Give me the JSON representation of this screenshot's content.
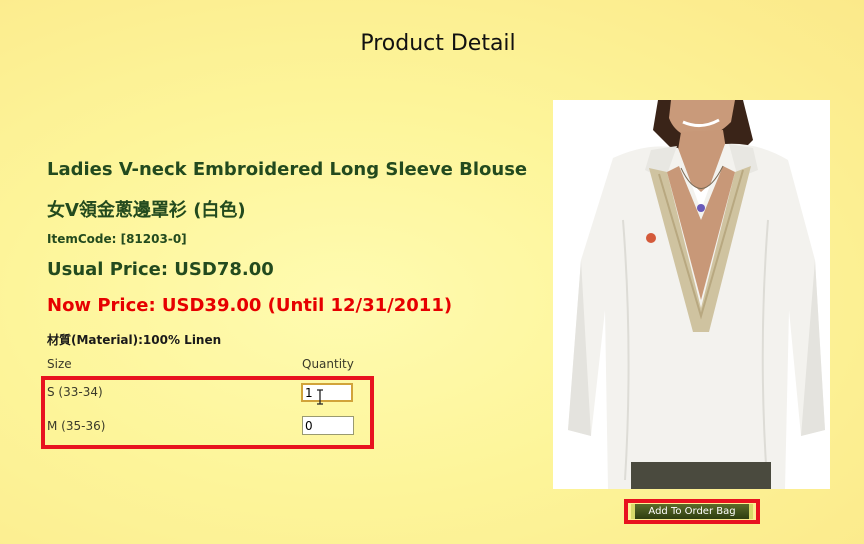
{
  "page": {
    "title": "Product Detail"
  },
  "product": {
    "name": "Ladies V-neck Embroidered Long Sleeve Blouse",
    "name_cn": "女V領金蔥邊罩衫 (白色)",
    "item_code": "ItemCode: [81203-0]",
    "usual_price": "Usual Price: USD78.00",
    "now_price": "Now Price: USD39.00 (Until 12/31/2011)",
    "material": "材質(Material):100% Linen"
  },
  "order_table": {
    "size_header": "Size",
    "quantity_header": "Quantity",
    "rows": [
      {
        "size": "S (33-34)",
        "quantity": "1"
      },
      {
        "size": "M (35-36)",
        "quantity": "0"
      }
    ]
  },
  "actions": {
    "add_to_bag": "Add To Order Bag"
  },
  "colors": {
    "background": "#fdf59a",
    "text_green": "#234a1e",
    "now_price_red": "#e60000",
    "highlight_red": "#e8121f",
    "button_dark": "#2e3d10"
  },
  "icons": {
    "cursor": "text-cursor-icon"
  }
}
